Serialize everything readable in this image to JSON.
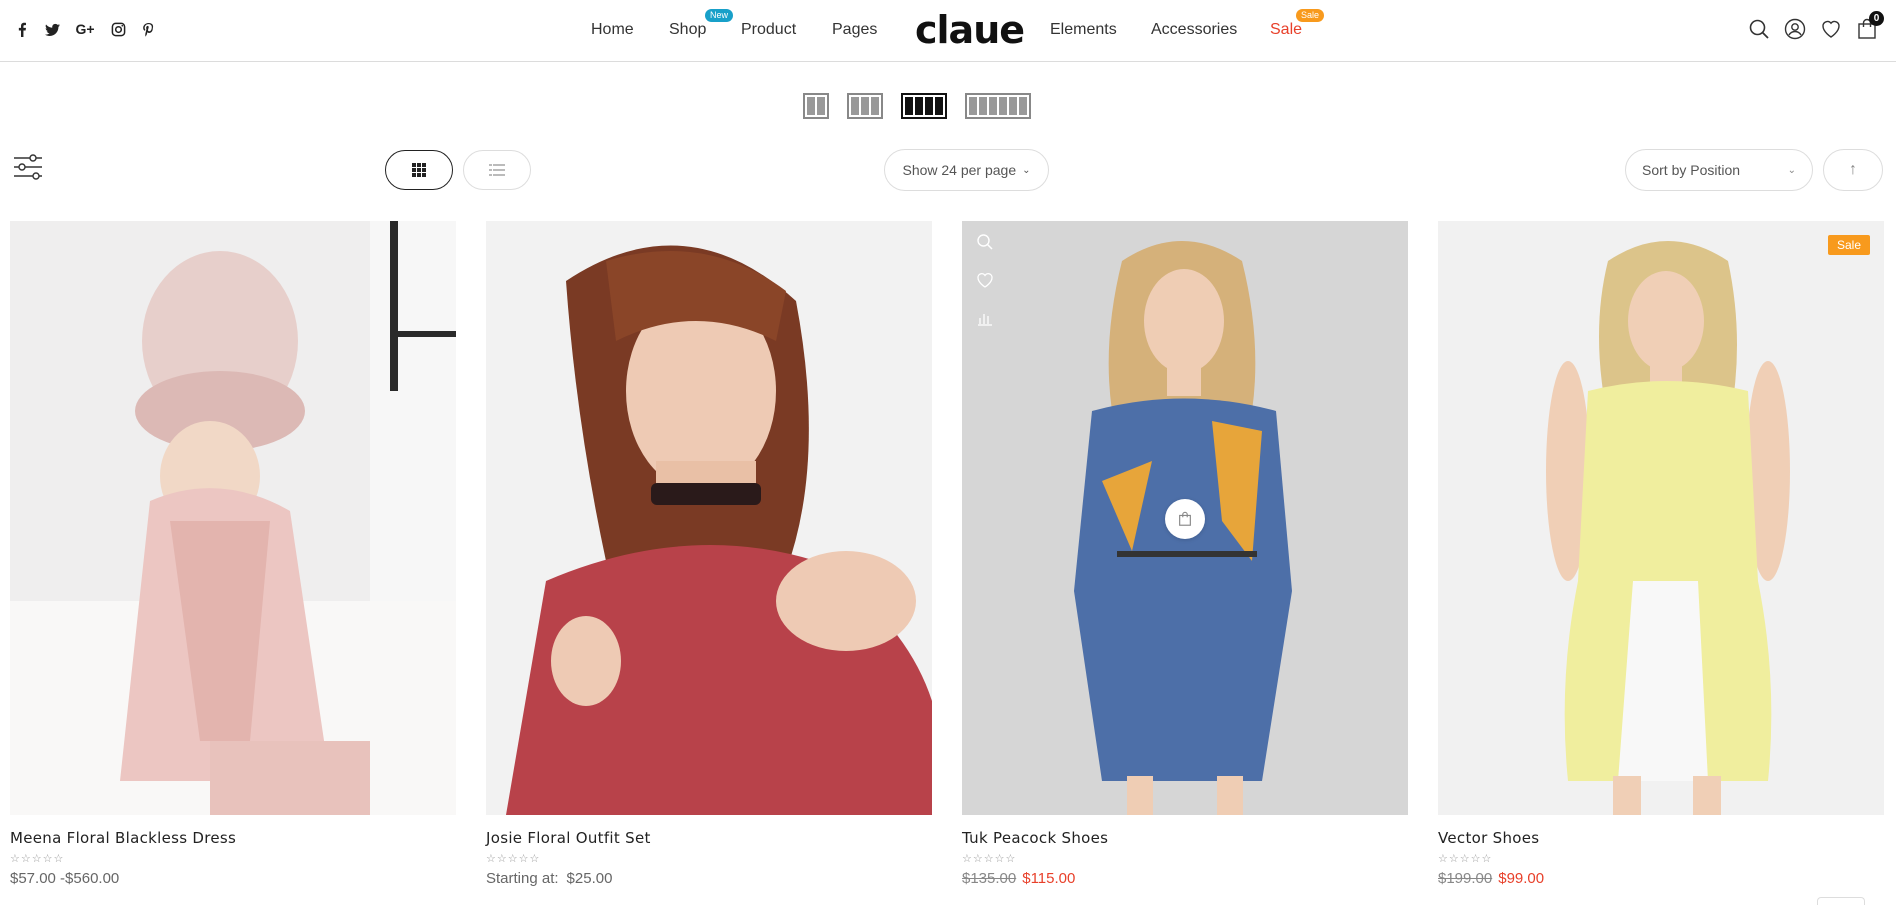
{
  "header": {
    "logo": "claue",
    "nav": [
      {
        "label": "Home"
      },
      {
        "label": "Shop",
        "badge": "New"
      },
      {
        "label": "Product"
      },
      {
        "label": "Pages"
      },
      {
        "label": "Elements"
      },
      {
        "label": "Accessories"
      },
      {
        "label": "Sale",
        "badge": "Sale"
      }
    ],
    "social_icons": [
      "facebook-icon",
      "twitter-icon",
      "google-plus-icon",
      "instagram-icon",
      "pinterest-icon"
    ],
    "action_icons": [
      "search-icon",
      "user-icon",
      "heart-icon",
      "cart-icon"
    ],
    "cart_count": "0"
  },
  "toolbar": {
    "column_options": [
      2,
      3,
      4,
      6
    ],
    "active_columns": 4,
    "per_page": "Show 24 per page",
    "sort": "Sort by Position"
  },
  "products": [
    {
      "name": "Meena Floral Blackless Dress",
      "price": "$57.00 -$560.00",
      "rating": 0
    },
    {
      "name": "Josie Floral Outfit Set",
      "price_label": "Starting at:",
      "price": "$25.00",
      "rating": 0
    },
    {
      "name": "Tuk Peacock Shoes",
      "old_price": "$135.00",
      "new_price": "$115.00",
      "rating": 0
    },
    {
      "name": "Vector Shoes",
      "old_price": "$199.00",
      "new_price": "$99.00",
      "badge": "Sale",
      "rating": 0
    }
  ],
  "colors": {
    "accent": "#e8402a",
    "badge_new": "#18a0c9",
    "badge_sale": "#f89a1d"
  }
}
